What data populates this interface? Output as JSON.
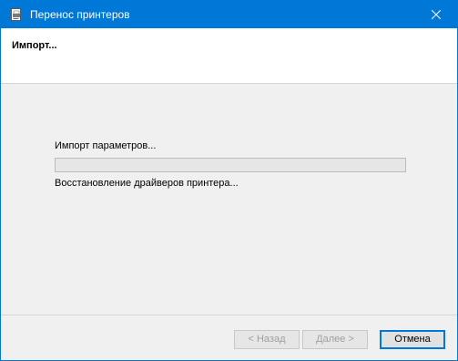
{
  "window": {
    "title": "Перенос принтеров",
    "accent_color": "#0078d7"
  },
  "header": {
    "title": "Импорт..."
  },
  "main": {
    "status_label": "Импорт параметров...",
    "progress_fraction": 0,
    "detail_label": "Восстановление драйверов принтера..."
  },
  "buttons": {
    "back_label": "< Назад",
    "next_label": "Далее >",
    "cancel_label": "Отмена"
  },
  "icons": {
    "app": "printer-migration-icon",
    "close": "close-icon"
  }
}
